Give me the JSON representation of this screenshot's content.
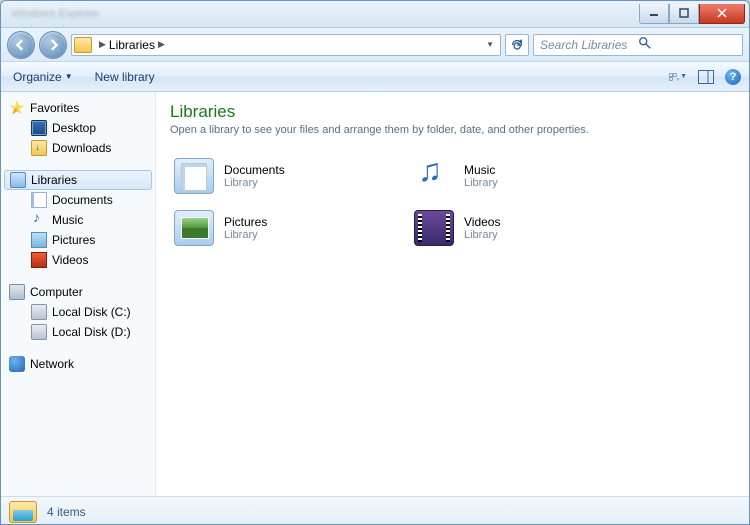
{
  "title_blurred": "Windows Explorer",
  "address": {
    "location": "Libraries"
  },
  "search": {
    "placeholder": "Search Libraries"
  },
  "toolbar": {
    "organize": "Organize",
    "new_library": "New library"
  },
  "sidebar": {
    "favorites": {
      "label": "Favorites",
      "items": [
        "Desktop",
        "Downloads"
      ]
    },
    "libraries": {
      "label": "Libraries",
      "items": [
        "Documents",
        "Music",
        "Pictures",
        "Videos"
      ]
    },
    "computer": {
      "label": "Computer",
      "items": [
        "Local Disk (C:)",
        "Local Disk (D:)"
      ]
    },
    "network": {
      "label": "Network"
    }
  },
  "content": {
    "heading": "Libraries",
    "subheading": "Open a library to see your files and arrange them by folder, date, and other properties.",
    "items": [
      {
        "name": "Documents",
        "type": "Library"
      },
      {
        "name": "Music",
        "type": "Library"
      },
      {
        "name": "Pictures",
        "type": "Library"
      },
      {
        "name": "Videos",
        "type": "Library"
      }
    ]
  },
  "status": {
    "text": "4 items"
  }
}
